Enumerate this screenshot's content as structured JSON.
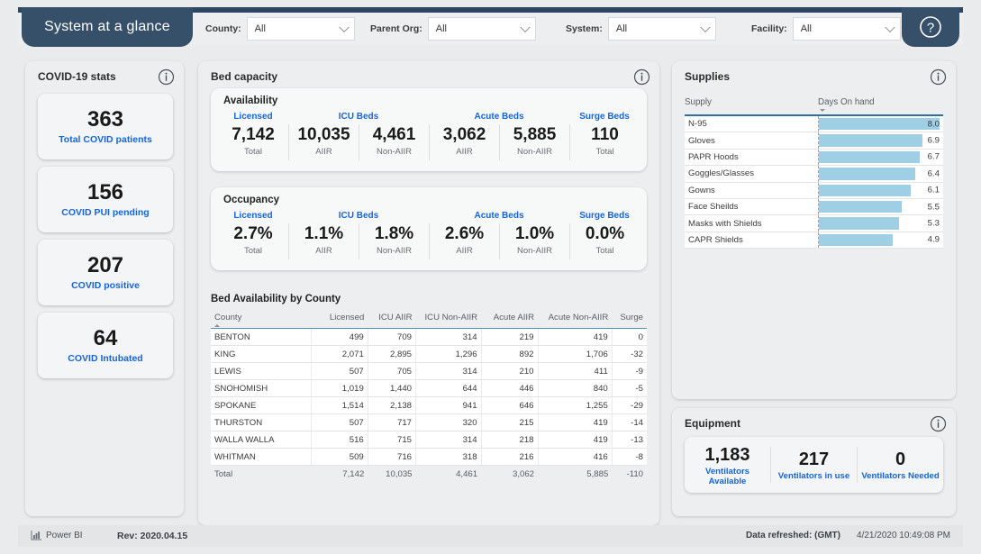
{
  "header": {
    "tab_title": "System at a glance",
    "help_icon": "question-mark-circle-icon",
    "filters": [
      {
        "label": "County:",
        "value": "All"
      },
      {
        "label": "Parent Org:",
        "value": "All"
      },
      {
        "label": "System:",
        "value": "All"
      },
      {
        "label": "Facility:",
        "value": "All"
      }
    ]
  },
  "covid": {
    "title": "COVID-19 stats",
    "info_icon": "info-circle-icon",
    "cards": [
      {
        "value": "363",
        "caption": "Total COVID patients"
      },
      {
        "value": "156",
        "caption": "COVID PUI pending"
      },
      {
        "value": "207",
        "caption": "COVID positive"
      },
      {
        "value": "64",
        "caption": "COVID Intubated"
      }
    ]
  },
  "bed_capacity": {
    "title": "Bed capacity",
    "info_icon": "info-circle-icon",
    "availability": {
      "title": "Availability",
      "groups": [
        {
          "head": "Licensed",
          "cells": [
            {
              "value": "7,142",
              "sub": "Total"
            }
          ]
        },
        {
          "head": "ICU Beds",
          "cells": [
            {
              "value": "10,035",
              "sub": "AIIR"
            },
            {
              "value": "4,461",
              "sub": "Non-AIIR"
            }
          ]
        },
        {
          "head": "Acute Beds",
          "cells": [
            {
              "value": "3,062",
              "sub": "AIIR"
            },
            {
              "value": "5,885",
              "sub": "Non-AIIR"
            }
          ]
        },
        {
          "head": "Surge Beds",
          "cells": [
            {
              "value": "110",
              "sub": "Total"
            }
          ]
        }
      ]
    },
    "occupancy": {
      "title": "Occupancy",
      "groups": [
        {
          "head": "Licensed",
          "cells": [
            {
              "value": "2.7%",
              "sub": "Total"
            }
          ]
        },
        {
          "head": "ICU Beds",
          "cells": [
            {
              "value": "1.1%",
              "sub": "AIIR"
            },
            {
              "value": "1.8%",
              "sub": "Non-AIIR"
            }
          ]
        },
        {
          "head": "Acute Beds",
          "cells": [
            {
              "value": "2.6%",
              "sub": "AIIR"
            },
            {
              "value": "1.0%",
              "sub": "Non-AIIR"
            }
          ]
        },
        {
          "head": "Surge Beds",
          "cells": [
            {
              "value": "0.0%",
              "sub": "Total"
            }
          ]
        }
      ]
    },
    "table": {
      "title": "Bed Availability by County",
      "columns": [
        "County",
        "Licensed",
        "ICU AIIR",
        "ICU Non-AIIR",
        "Acute AIIR",
        "Acute Non-AIIR",
        "Surge"
      ],
      "sorted_column": "County",
      "sort_direction": "asc",
      "rows": [
        [
          "BENTON",
          "499",
          "709",
          "314",
          "219",
          "419",
          "0"
        ],
        [
          "KING",
          "2,071",
          "2,895",
          "1,296",
          "892",
          "1,706",
          "-32"
        ],
        [
          "LEWIS",
          "507",
          "705",
          "314",
          "210",
          "411",
          "-9"
        ],
        [
          "SNOHOMISH",
          "1,019",
          "1,440",
          "644",
          "446",
          "840",
          "-5"
        ],
        [
          "SPOKANE",
          "1,514",
          "2,138",
          "941",
          "646",
          "1,255",
          "-29"
        ],
        [
          "THURSTON",
          "507",
          "717",
          "320",
          "215",
          "419",
          "-14"
        ],
        [
          "WALLA WALLA",
          "516",
          "715",
          "314",
          "218",
          "419",
          "-13"
        ],
        [
          "WHITMAN",
          "509",
          "716",
          "318",
          "216",
          "416",
          "-8"
        ]
      ],
      "total_row": [
        "Total",
        "7,142",
        "10,035",
        "4,461",
        "3,062",
        "5,885",
        "-110"
      ]
    }
  },
  "supplies": {
    "title": "Supplies",
    "info_icon": "info-circle-icon",
    "columns": [
      "Supply",
      "Days On hand"
    ],
    "sorted_column": "Days On hand",
    "sort_direction": "desc",
    "bar_color": "#9fcfe5",
    "max_value": 8.0,
    "rows": [
      {
        "name": "N-95",
        "value": "8.0",
        "num": 8.0
      },
      {
        "name": "Gloves",
        "value": "6.9",
        "num": 6.9
      },
      {
        "name": "PAPR Hoods",
        "value": "6.7",
        "num": 6.7
      },
      {
        "name": "Goggles/Glasses",
        "value": "6.4",
        "num": 6.4
      },
      {
        "name": "Gowns",
        "value": "6.1",
        "num": 6.1
      },
      {
        "name": "Face Sheilds",
        "value": "5.5",
        "num": 5.5
      },
      {
        "name": "Masks with Shields",
        "value": "5.3",
        "num": 5.3
      },
      {
        "name": "CAPR Shields",
        "value": "4.9",
        "num": 4.9
      }
    ]
  },
  "equipment": {
    "title": "Equipment",
    "info_icon": "info-circle-icon",
    "cells": [
      {
        "value": "1,183",
        "caption": "Ventilators Available"
      },
      {
        "value": "217",
        "caption": "Ventilators in use"
      },
      {
        "value": "0",
        "caption": "Ventilators Needed"
      }
    ]
  },
  "footer": {
    "powerbi_icon": "power-bi-icon",
    "powerbi_label": "Power BI",
    "revision": "Rev: 2020.04.15",
    "refresh_label": "Data refreshed: (GMT)",
    "refresh_value": "4/21/2020 10:49:08 PM"
  },
  "chart_data": {
    "type": "bar",
    "title": "Supplies",
    "orientation": "horizontal",
    "xlabel": "Days On hand",
    "ylabel": "Supply",
    "categories": [
      "N-95",
      "Gloves",
      "PAPR Hoods",
      "Goggles/Glasses",
      "Gowns",
      "Face Sheilds",
      "Masks with Shields",
      "CAPR Shields"
    ],
    "values": [
      8.0,
      6.9,
      6.7,
      6.4,
      6.1,
      5.5,
      5.3,
      4.9
    ],
    "xlim": [
      0,
      8.0
    ],
    "grid": false,
    "legend": "none",
    "bar_color": "#9fcfe5"
  }
}
